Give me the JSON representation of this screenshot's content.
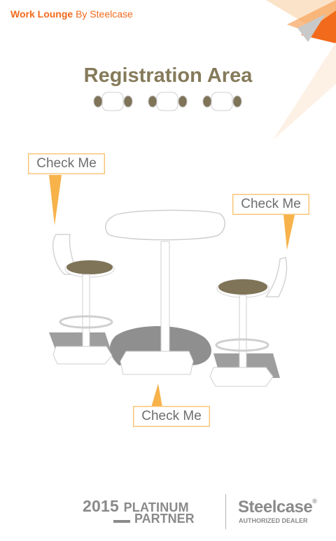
{
  "header": {
    "brand": "Work Lounge",
    "by": " By Steelcase"
  },
  "title": "Registration Area",
  "callouts": [
    "Check Me",
    "Check Me",
    "Check Me"
  ],
  "footer": {
    "year": "2015",
    "platinum": "PLATINUM",
    "partner": "PARTNER",
    "steelcase": "Steelcase",
    "authorized_dealer": "AUTHORIZED DEALER"
  },
  "colors": {
    "orange": "#f26a1b",
    "title": "#857a5a",
    "seat": "#7f7358",
    "callout_border": "#f7c376",
    "footer_gray": "#8a8a8a"
  }
}
